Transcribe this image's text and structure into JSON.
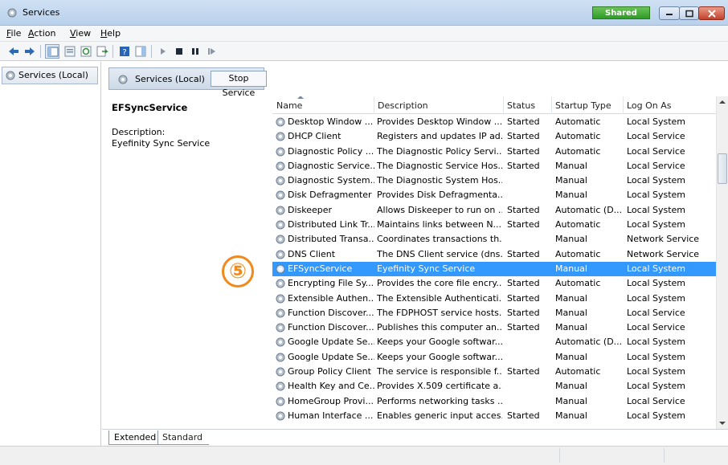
{
  "window": {
    "title": "Services",
    "badge": "Shared"
  },
  "menu": [
    {
      "label": "File",
      "u": "F",
      "rest": "ile"
    },
    {
      "label": "Action",
      "u": "A",
      "rest": "ction"
    },
    {
      "label": "View",
      "u": "V",
      "rest": "iew"
    },
    {
      "label": "Help",
      "u": "H",
      "rest": "elp"
    }
  ],
  "tree": {
    "root_label": "Services (Local)"
  },
  "panel": {
    "header_label": "Services (Local)",
    "stop_button": "Stop Service"
  },
  "detail": {
    "service_name": "EFSyncService",
    "description_label": "Description:",
    "description": "Eyefinity Sync Service"
  },
  "annotation": {
    "number": "⑤",
    "color": "#f08a1c"
  },
  "columns": {
    "name": "Name",
    "description": "Description",
    "status": "Status",
    "startup": "Startup Type",
    "logon": "Log On As"
  },
  "services": [
    {
      "name": "Desktop Window ...",
      "description": "Provides Desktop Window ...",
      "status": "Started",
      "startup": "Automatic",
      "logon": "Local System"
    },
    {
      "name": "DHCP Client",
      "description": "Registers and updates IP ad...",
      "status": "Started",
      "startup": "Automatic",
      "logon": "Local Service"
    },
    {
      "name": "Diagnostic Policy ...",
      "description": "The Diagnostic Policy Servi...",
      "status": "Started",
      "startup": "Automatic",
      "logon": "Local Service"
    },
    {
      "name": "Diagnostic Service...",
      "description": "The Diagnostic Service Hos...",
      "status": "Started",
      "startup": "Manual",
      "logon": "Local Service"
    },
    {
      "name": "Diagnostic System...",
      "description": "The Diagnostic System Hos...",
      "status": "",
      "startup": "Manual",
      "logon": "Local System"
    },
    {
      "name": "Disk Defragmenter",
      "description": "Provides Disk Defragmenta...",
      "status": "",
      "startup": "Manual",
      "logon": "Local System"
    },
    {
      "name": "Diskeeper",
      "description": "Allows Diskeeper to run on ...",
      "status": "Started",
      "startup": "Automatic (D...",
      "logon": "Local System"
    },
    {
      "name": "Distributed Link Tr...",
      "description": "Maintains links between N...",
      "status": "Started",
      "startup": "Automatic",
      "logon": "Local System"
    },
    {
      "name": "Distributed Transa...",
      "description": "Coordinates transactions th...",
      "status": "",
      "startup": "Manual",
      "logon": "Network Service"
    },
    {
      "name": "DNS Client",
      "description": "The DNS Client service (dns...",
      "status": "Started",
      "startup": "Automatic",
      "logon": "Network Service"
    },
    {
      "name": "EFSyncService",
      "description": "Eyefinity Sync Service",
      "status": "",
      "startup": "Manual",
      "logon": "Local System",
      "selected": true
    },
    {
      "name": "Encrypting File Sy...",
      "description": "Provides the core file encry...",
      "status": "Started",
      "startup": "Automatic",
      "logon": "Local System"
    },
    {
      "name": "Extensible Authen...",
      "description": "The Extensible Authenticati...",
      "status": "Started",
      "startup": "Manual",
      "logon": "Local System"
    },
    {
      "name": "Function Discover...",
      "description": "The FDPHOST service hosts...",
      "status": "Started",
      "startup": "Manual",
      "logon": "Local Service"
    },
    {
      "name": "Function Discover...",
      "description": "Publishes this computer an...",
      "status": "Started",
      "startup": "Manual",
      "logon": "Local Service"
    },
    {
      "name": "Google Update Se...",
      "description": "Keeps your Google softwar...",
      "status": "",
      "startup": "Automatic (D...",
      "logon": "Local System"
    },
    {
      "name": "Google Update Se...",
      "description": "Keeps your Google softwar...",
      "status": "",
      "startup": "Manual",
      "logon": "Local System"
    },
    {
      "name": "Group Policy Client",
      "description": "The service is responsible f...",
      "status": "Started",
      "startup": "Automatic",
      "logon": "Local System"
    },
    {
      "name": "Health Key and Ce...",
      "description": "Provides X.509 certificate a...",
      "status": "",
      "startup": "Manual",
      "logon": "Local System"
    },
    {
      "name": "HomeGroup Provi...",
      "description": "Performs networking tasks ...",
      "status": "",
      "startup": "Manual",
      "logon": "Local Service"
    },
    {
      "name": "Human Interface ...",
      "description": "Enables generic input acces...",
      "status": "Started",
      "startup": "Manual",
      "logon": "Local System"
    }
  ],
  "bottom_tabs": {
    "extended": "Extended",
    "standard": "Standard"
  }
}
